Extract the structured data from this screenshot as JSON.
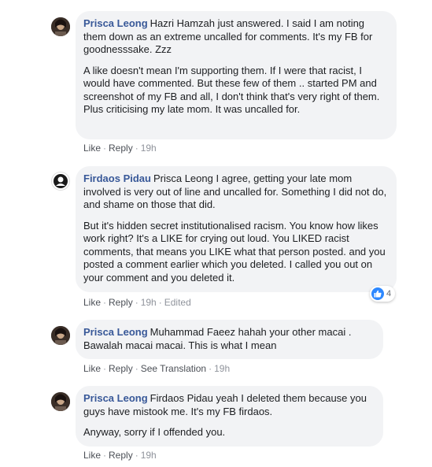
{
  "comments": [
    {
      "author": "Prisca Leong",
      "paragraphs": [
        "Hazri Hamzah just answered. I said I am noting them down as an extreme uncalled for comments. It's my FB for goodnesssake. Zzz",
        "A like doesn't mean I'm supporting them. If I were that racist, I would have commented. But these few of them .. started PM and screenshot of my FB and all, I don't think that's very right of them. Plus criticising my late mom. It was uncalled for."
      ],
      "actions": {
        "like": "Like",
        "reply": "Reply",
        "time": "19h"
      }
    },
    {
      "author": "Firdaos Pidau",
      "paragraphs": [
        "Prisca Leong I agree, getting your late mom involved is very out of line and uncalled for. Something I did not do, and shame on those that did.",
        "But it's hidden secret institutionalised racism. You know how likes work right? It's a LIKE for crying out loud. You LIKED racist comments, that means you LIKE what that person posted. and you posted a comment earlier which you deleted. I called you out on your comment and you deleted it."
      ],
      "actions": {
        "like": "Like",
        "reply": "Reply",
        "time": "19h",
        "edited": "Edited"
      },
      "reactions": {
        "icon": "like-icon",
        "count": "4",
        "color": "#2d88ff"
      }
    },
    {
      "author": "Prisca Leong",
      "paragraphs": [
        "Muhammad Faeez hahah your other macai . Bawalah macai macai. This is what I mean"
      ],
      "actions": {
        "like": "Like",
        "reply": "Reply",
        "translation": "See Translation",
        "time": "19h"
      }
    },
    {
      "author": "Prisca Leong",
      "paragraphs": [
        "Firdaos Pidau yeah I deleted them because you guys have mistook me. It's my FB firdaos.",
        "Anyway, sorry if I offended you."
      ],
      "actions": {
        "like": "Like",
        "reply": "Reply",
        "time": "19h"
      }
    }
  ],
  "colors": {
    "author": "#385898",
    "bubble": "#f2f3f5",
    "meta": "#90949c"
  }
}
